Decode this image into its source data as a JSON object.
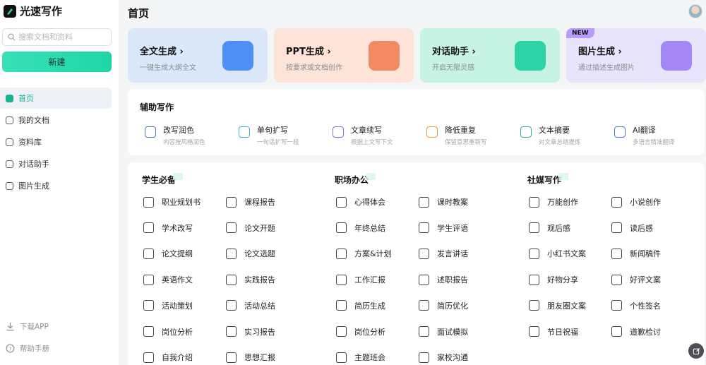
{
  "app": {
    "name": "光速写作"
  },
  "sidebar": {
    "search_placeholder": "搜索文档和资料",
    "new_label": "新建",
    "items": [
      {
        "label": "首页",
        "icon": "home-icon"
      },
      {
        "label": "我的文档",
        "icon": "document-icon"
      },
      {
        "label": "资料库",
        "icon": "library-icon"
      },
      {
        "label": "对话助手",
        "icon": "chat-icon"
      },
      {
        "label": "图片生成",
        "icon": "image-icon"
      }
    ],
    "download_label": "下载APP",
    "help_label": "帮助手册"
  },
  "header": {
    "title": "首页"
  },
  "cards": [
    {
      "title": "全文生成 ›",
      "subtitle": "一键生成大纲全文",
      "color": "#dbe7fb",
      "art": "#4f8ef5",
      "icon": "word-doc-icon"
    },
    {
      "title": "PPT生成 ›",
      "subtitle": "按要求或文档创作",
      "color": "#fde3d8",
      "art": "#f28a64",
      "icon": "ppt-icon"
    },
    {
      "title": "对话助手 ›",
      "subtitle": "开启无限灵感",
      "color": "#c7f3e5",
      "art": "#2ed3a5",
      "icon": "ai-chat-icon"
    },
    {
      "title": "图片生成 ›",
      "subtitle": "通过描述生成图片",
      "color": "#e7e4fb",
      "art": "#a287f5",
      "icon": "picture-icon",
      "badge": "NEW"
    }
  ],
  "aux": {
    "title": "辅助写作",
    "items": [
      {
        "name": "改写润色",
        "desc": "内容按风格润色",
        "color": "#4a7ad8"
      },
      {
        "name": "单句扩写",
        "desc": "一句话扩写一段",
        "color": "#3fb6c9"
      },
      {
        "name": "文章续写",
        "desc": "根据上文写下文",
        "color": "#8d6be0"
      },
      {
        "name": "降低重复",
        "desc": "保留意思重新写",
        "color": "#f19a3a"
      },
      {
        "name": "文本摘要",
        "desc": "对文章总结提炼",
        "color": "#2fb59a"
      },
      {
        "name": "AI翻译",
        "desc": "多语言精准翻译",
        "color": "#4a7ad8"
      }
    ]
  },
  "categories": [
    {
      "title": "学生必备",
      "items": [
        "职业规划书",
        "课程报告",
        "学术改写",
        "论文开题",
        "论文提纲",
        "论文选题",
        "英语作文",
        "实践报告",
        "活动策划",
        "活动总结",
        "岗位分析",
        "实习报告",
        "自我介绍",
        "思想汇报"
      ]
    },
    {
      "title": "职场办公",
      "items": [
        "心得体会",
        "课时教案",
        "年终总结",
        "学生评语",
        "方案&计划",
        "发言讲话",
        "工作汇报",
        "述职报告",
        "简历生成",
        "简历优化",
        "岗位分析",
        "面试模拟",
        "主题班会",
        "家校沟通"
      ]
    },
    {
      "title": "社媒写作",
      "items": [
        "万能创作",
        "小说创作",
        "观后感",
        "读后感",
        "小红书文案",
        "新闻稿件",
        "好物分享",
        "好评文案",
        "朋友圈文案",
        "个性签名",
        "节日祝福",
        "道歉检讨"
      ]
    }
  ]
}
